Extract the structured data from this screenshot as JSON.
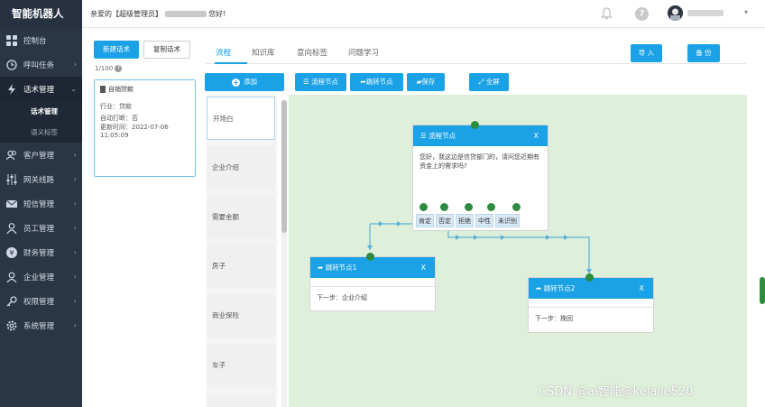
{
  "app": {
    "title": "智能机器人"
  },
  "topbar": {
    "welcome_prefix": "亲爱的【超级管理员】",
    "welcome_suffix": "您好!"
  },
  "sidebar": {
    "items": [
      {
        "label": "控制台",
        "icon": "dashboard-icon"
      },
      {
        "label": "呼叫任务",
        "icon": "clock-icon"
      },
      {
        "label": "话术管理",
        "icon": "flash-icon"
      },
      {
        "label": "客户管理",
        "icon": "users-icon"
      },
      {
        "label": "网关线路",
        "icon": "sliders-icon"
      },
      {
        "label": "短信管理",
        "icon": "mail-icon"
      },
      {
        "label": "员工管理",
        "icon": "user-icon"
      },
      {
        "label": "财务管理",
        "icon": "yen-icon"
      },
      {
        "label": "企业管理",
        "icon": "enterprise-icon"
      },
      {
        "label": "权限管理",
        "icon": "key-icon"
      },
      {
        "label": "系统管理",
        "icon": "gear-icon"
      }
    ],
    "sub_items": [
      "话术管理",
      "语义标签"
    ]
  },
  "script_panel": {
    "new_label": "新建话术",
    "copy_label": "复制话术",
    "count": "1/100",
    "card": {
      "title": "自销贷款",
      "industry": "行业：贷款",
      "auto_hangup": "自动打断：否",
      "updated": "更新时间：2022-07-06 11:05:09"
    }
  },
  "main": {
    "tabs": [
      "流程",
      "知识库",
      "意向标签",
      "问题学习"
    ],
    "import_label": "导 入",
    "backup_label": "备 份",
    "toolbar": {
      "add": "添加",
      "flow_node": "流程节点",
      "jump_node": "跳转节点",
      "save": "保存",
      "fullscreen": "全屏"
    },
    "node_list": [
      "开场白",
      "企业介绍",
      "需要金额",
      "房子",
      "商业保险",
      "车子"
    ]
  },
  "flow": {
    "main_node": {
      "title": "流程节点",
      "close": "X",
      "text": "您好，我这边是信贷部门的，请问您近期有资金上的需求吗?",
      "branches": [
        "肯定",
        "否定",
        "拒绝",
        "中性",
        "未识别"
      ]
    },
    "jump1": {
      "title": "跳转节点1",
      "close": "X",
      "next": "下一步：企业介绍"
    },
    "jump2": {
      "title": "跳转节点2",
      "close": "X",
      "next": "下一步：挽回"
    }
  },
  "watermark": "CSDN @ai智能@kelaile520",
  "colors": {
    "primary": "#1aa1e6",
    "sidebar": "#2b3645",
    "canvas": "#dff0da",
    "connector": "#5ab0d8",
    "anchor": "#2e8b3f"
  }
}
